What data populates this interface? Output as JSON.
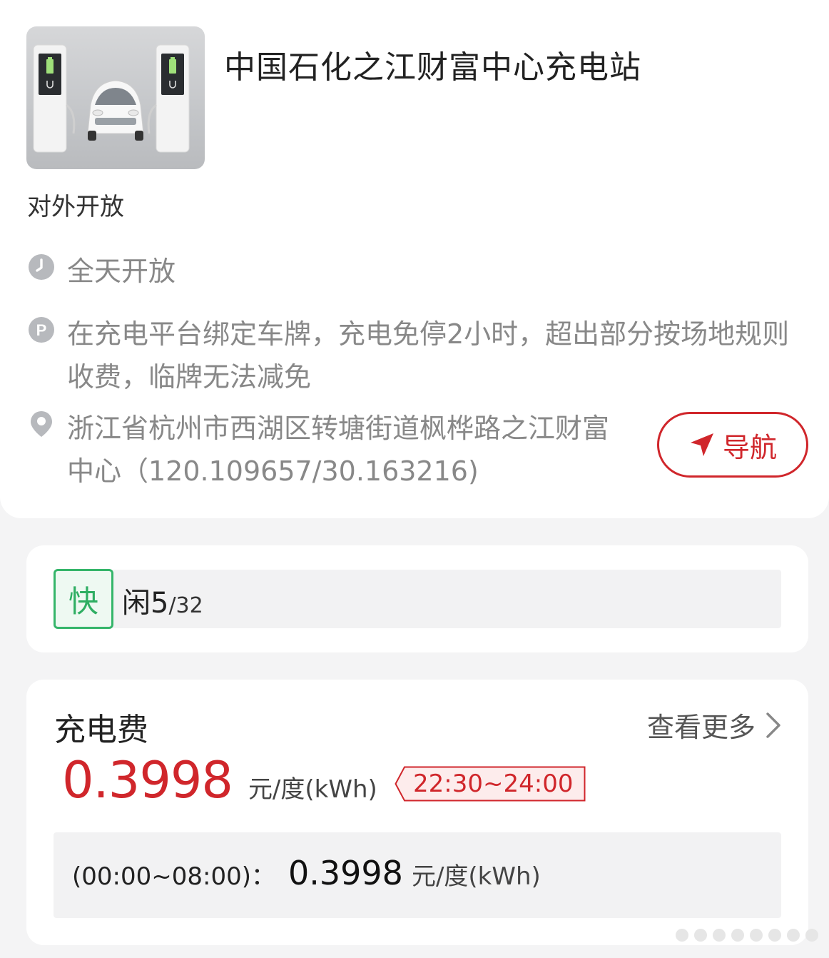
{
  "station": {
    "title": "中国石化之江财富中心充电站",
    "open_tag": "对外开放",
    "hours": "全天开放",
    "parking": "在充电平台绑定车牌，充电免停2小时，超出部分按场地规则收费，临牌无法减免",
    "address": "浙江省杭州市西湖区转塘街道枫桦路之江财富中心（120.109657/30.163216)",
    "nav_label": "导航"
  },
  "availability": {
    "type_badge": "快",
    "idle_label": "闲",
    "free": "5",
    "total": "/32"
  },
  "fee": {
    "title": "充电费",
    "more_label": "查看更多",
    "current_price": "0.3998",
    "unit": "元/度(kWh)",
    "current_period": "22:30~24:00",
    "periods": [
      {
        "label": "(00:00~08:00)：",
        "price": "0.3998",
        "unit": "元/度(kWh)"
      }
    ]
  },
  "colors": {
    "accent_red": "#d0262b",
    "fast_green": "#2fae63",
    "muted_text": "#888888",
    "background": "#f4f4f5"
  },
  "icons": [
    "clock-icon",
    "parking-icon",
    "location-pin-icon",
    "navigation-arrow-icon",
    "chevron-right-icon"
  ]
}
